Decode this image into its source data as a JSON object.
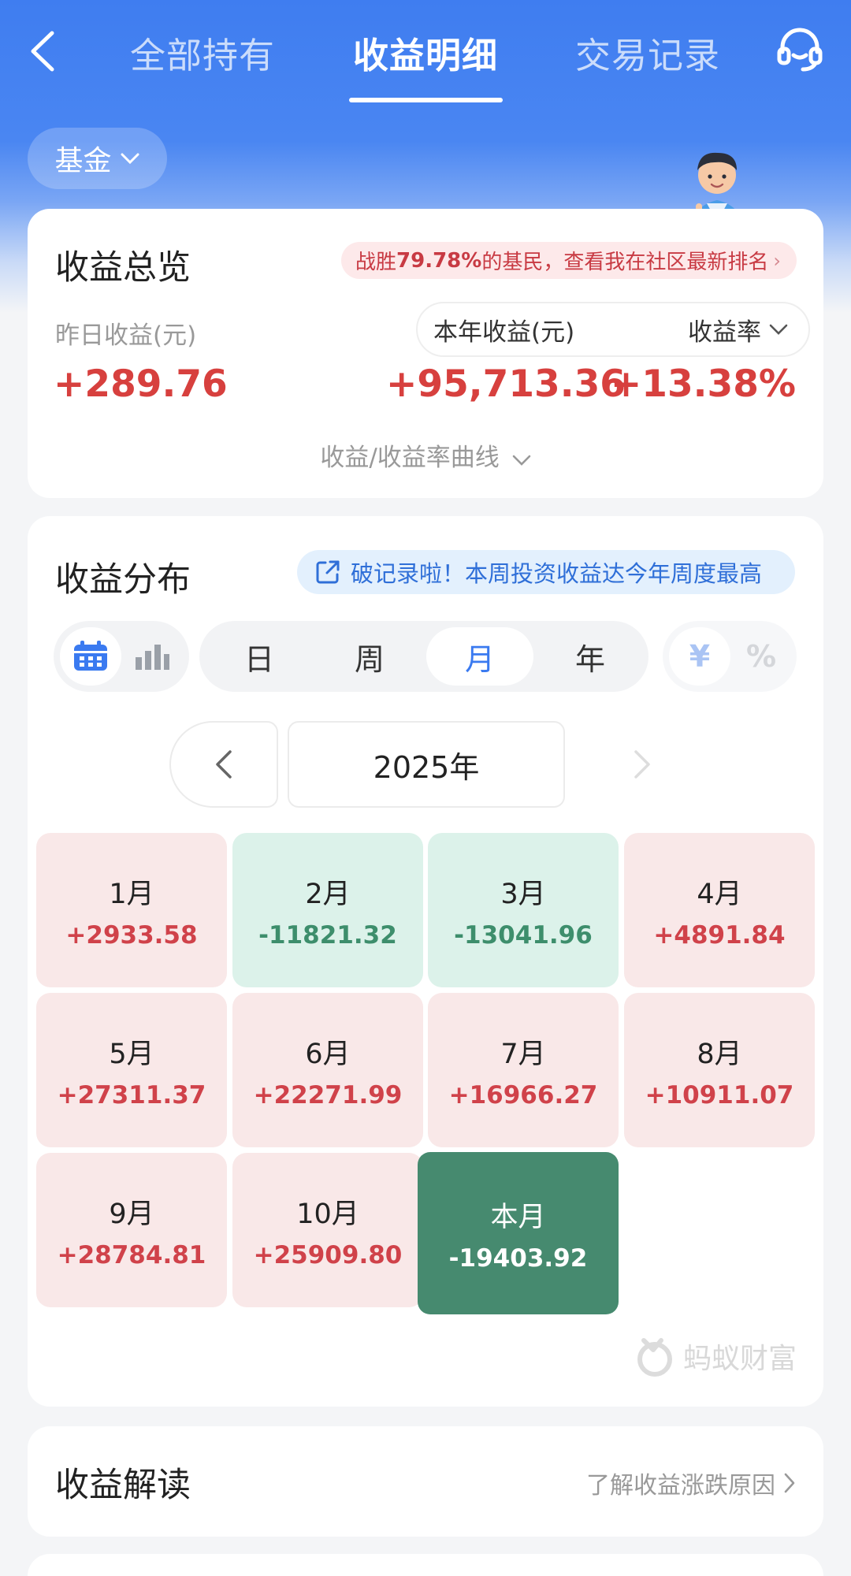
{
  "nav": {
    "tabs": [
      "全部持有",
      "收益明细",
      "交易记录"
    ],
    "active_tab": "收益明细"
  },
  "filter": {
    "label": "基金"
  },
  "overview": {
    "title": "收益总览",
    "rank_prefix": "战胜",
    "rank_value": "79.78%",
    "rank_suffix": "的基民，查看我在社区最新排名",
    "yesterday_label": "昨日收益(元)",
    "yesterday_value": "+289.76",
    "year_label": "本年收益(元)",
    "rate_label": "收益率",
    "year_value": "+95,713.36",
    "rate_value": "+13.38%",
    "curve_link": "收益/收益率曲线"
  },
  "distribution": {
    "title": "收益分布",
    "record_text": "破记录啦！本周投资收益达今年周度最高",
    "periods": [
      "日",
      "周",
      "月",
      "年"
    ],
    "active_period": "月",
    "units": [
      "¥",
      "%"
    ],
    "year": "2025年",
    "months": [
      {
        "label": "1月",
        "value": "+2933.58",
        "trend": "pos"
      },
      {
        "label": "2月",
        "value": "-11821.32",
        "trend": "neg"
      },
      {
        "label": "3月",
        "value": "-13041.96",
        "trend": "neg"
      },
      {
        "label": "4月",
        "value": "+4891.84",
        "trend": "pos"
      },
      {
        "label": "5月",
        "value": "+27311.37",
        "trend": "pos"
      },
      {
        "label": "6月",
        "value": "+22271.99",
        "trend": "pos"
      },
      {
        "label": "7月",
        "value": "+16966.27",
        "trend": "pos"
      },
      {
        "label": "8月",
        "value": "+10911.07",
        "trend": "pos"
      },
      {
        "label": "9月",
        "value": "+28784.81",
        "trend": "pos"
      },
      {
        "label": "10月",
        "value": "+25909.80",
        "trend": "pos"
      },
      {
        "label": "本月",
        "value": "-19403.92",
        "trend": "cur"
      }
    ],
    "watermark": "蚂蚁财富"
  },
  "interpretation": {
    "title": "收益解读",
    "link": "了解收益涨跌原因"
  },
  "colors": {
    "primary_blue": "#3f7df0",
    "gain_red": "#d7403e",
    "loss_green": "#3d8e6c",
    "current_month_green": "#468a6f"
  }
}
